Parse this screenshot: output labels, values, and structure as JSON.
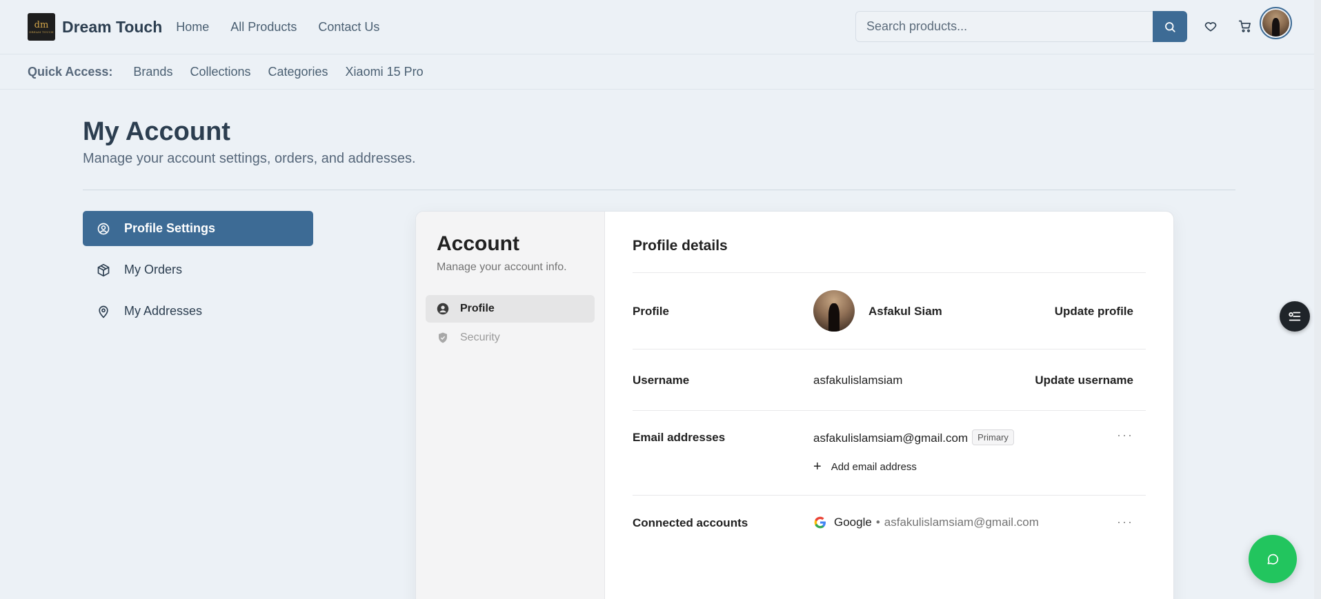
{
  "header": {
    "logo_text": "dm",
    "logo_subtext": "DREAM TOUCH",
    "brand": "Dream Touch",
    "nav": [
      "Home",
      "All Products",
      "Contact Us"
    ],
    "search_placeholder": "Search products...",
    "icons": [
      "search-icon",
      "heart-icon",
      "cart-icon",
      "avatar"
    ]
  },
  "quick_access": {
    "label": "Quick Access:",
    "links": [
      "Brands",
      "Collections",
      "Categories",
      "Xiaomi 15 Pro"
    ]
  },
  "page": {
    "title": "My Account",
    "subtitle": "Manage your account settings, orders, and addresses."
  },
  "sidenav": [
    {
      "label": "Profile Settings",
      "icon": "user-circle-icon",
      "active": true
    },
    {
      "label": "My Orders",
      "icon": "package-icon",
      "active": false
    },
    {
      "label": "My Addresses",
      "icon": "map-pin-icon",
      "active": false
    }
  ],
  "account": {
    "title": "Account",
    "subtitle": "Manage your account info.",
    "tabs": [
      {
        "label": "Profile",
        "icon": "user-icon",
        "active": true
      },
      {
        "label": "Security",
        "icon": "shield-icon",
        "active": false
      }
    ]
  },
  "profile_details": {
    "title": "Profile details",
    "profile": {
      "label": "Profile",
      "name": "Asfakul Siam",
      "action": "Update profile"
    },
    "username": {
      "label": "Username",
      "value": "asfakulislamsiam",
      "action": "Update username"
    },
    "email": {
      "label": "Email addresses",
      "value": "asfakulislamsiam@gmail.com",
      "badge": "Primary",
      "add": "Add email address"
    },
    "connected": {
      "label": "Connected accounts",
      "provider": "Google",
      "separator": "•",
      "email": "asfakulislamsiam@gmail.com"
    }
  },
  "colors": {
    "primary": "#3d6b95",
    "background": "#ecf1f6",
    "chat": "#22c55e"
  }
}
